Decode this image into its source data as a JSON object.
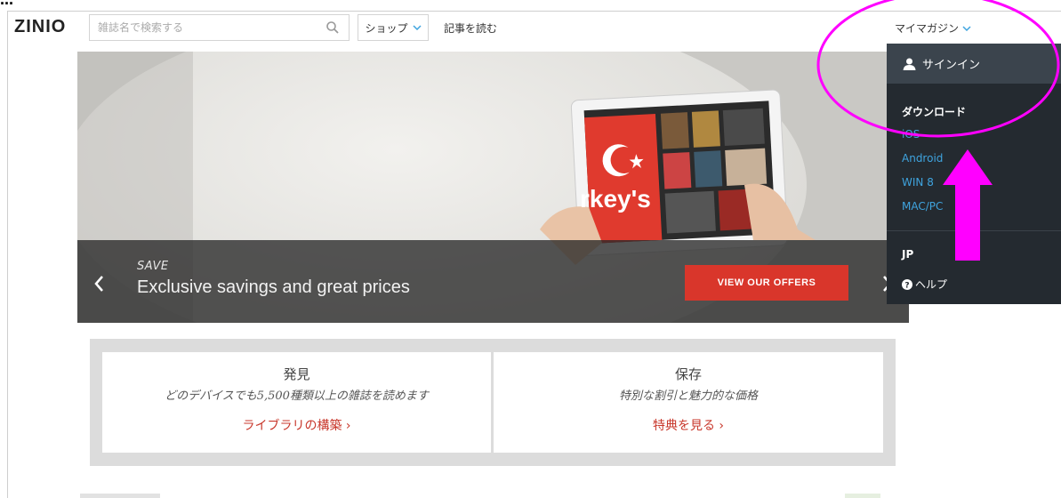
{
  "annotation_text": "…",
  "header": {
    "logo": "ZINIO",
    "search_placeholder": "雑誌名で検索する",
    "shop_label": "ショップ",
    "read_label": "記事を読む",
    "my_magazines_label": "マイマガジン"
  },
  "hero": {
    "kicker": "SAVE",
    "title": "Exclusive savings and great prices",
    "cta_label": "VIEW OUR OFFERS",
    "tablet_text": "rkey's"
  },
  "features": [
    {
      "title": "発見",
      "subtitle": "どのデバイスでも5,500種類以上の雑誌を読めます",
      "link": "ライブラリの構築 ›"
    },
    {
      "title": "保存",
      "subtitle": "特別な割引と魅力的な価格",
      "link": "特典を見る ›"
    }
  ],
  "dropdown": {
    "signin_label": "サインイン",
    "download_heading": "ダウンロード",
    "downloads": [
      "iOS",
      "Android",
      "WIN 8",
      "MAC/PC"
    ],
    "region": "JP",
    "help_label": "ヘルプ"
  },
  "colors": {
    "accent_red": "#d9362b",
    "link_blue": "#3fa4df",
    "dropdown_bg": "#242a30",
    "annotation_magenta": "#ff00ff"
  }
}
